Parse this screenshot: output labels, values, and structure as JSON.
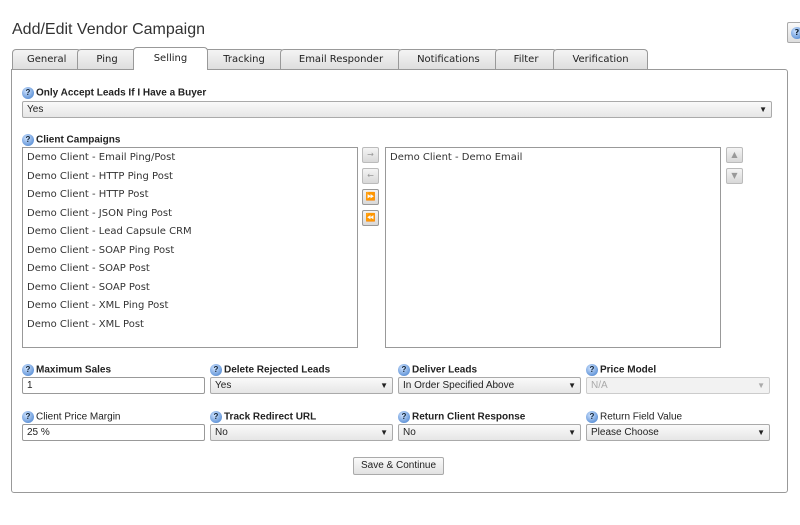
{
  "title": "Add/Edit Vendor Campaign",
  "help_icon": "?",
  "tabs": [
    "General",
    "Ping",
    "Selling",
    "Tracking",
    "Email Responder",
    "Notifications",
    "Filter",
    "Verification"
  ],
  "active_tab": "Selling",
  "only_accept": {
    "label": "Only Accept Leads If I Have a Buyer",
    "value": "Yes"
  },
  "client_campaigns": {
    "label": "Client Campaigns",
    "available": [
      "Demo Client - Email Ping/Post",
      "Demo Client - HTTP Ping Post",
      "Demo Client - HTTP Post",
      "Demo Client - JSON Ping Post",
      "Demo Client - Lead Capsule CRM",
      "Demo Client - SOAP Ping Post",
      "Demo Client - SOAP Post",
      "Demo Client - SOAP Post",
      "Demo Client - XML Ping Post",
      "Demo Client - XML Post"
    ],
    "selected": [
      "Demo Client - Demo Email"
    ],
    "buttons": {
      "add": "→",
      "remove": "←",
      "add_all": "⏩",
      "remove_all": "⏪",
      "up": "▲",
      "down": "▼"
    }
  },
  "fields": {
    "max_sales": {
      "label": "Maximum Sales",
      "value": "1"
    },
    "delete_rejected": {
      "label": "Delete Rejected Leads",
      "value": "Yes"
    },
    "deliver_leads": {
      "label": "Deliver Leads",
      "value": "In Order Specified Above"
    },
    "price_model": {
      "label": "Price Model",
      "value": "N/A"
    },
    "client_price_margin": {
      "label": "Client Price Margin",
      "value": "25 %"
    },
    "track_redirect": {
      "label": "Track Redirect URL",
      "value": "No"
    },
    "return_client_response": {
      "label": "Return Client Response",
      "value": "No"
    },
    "return_field_value": {
      "label": "Return Field Value",
      "value": "Please Choose"
    }
  },
  "save_label": "Save & Continue"
}
